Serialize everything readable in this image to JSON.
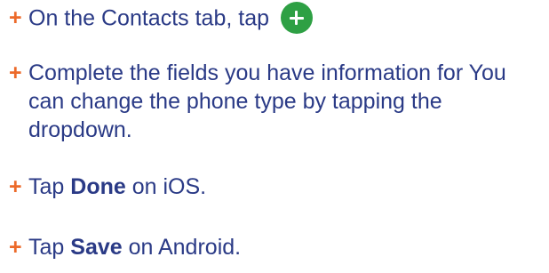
{
  "bullet": "+",
  "steps": [
    {
      "text": "On the Contacts tab, tap",
      "icon": "add-contact-icon"
    },
    {
      "text": "Complete the fields you have information for You can change the phone type by tapping the dropdown."
    },
    {
      "prefix": "Tap",
      "strong": "Done",
      "suffix": "on iOS."
    },
    {
      "prefix": "Tap",
      "strong": "Save",
      "suffix": "on Android."
    }
  ],
  "colors": {
    "text": "#2a3a86",
    "bullet": "#ec6a2a",
    "button": "#2ea044"
  }
}
